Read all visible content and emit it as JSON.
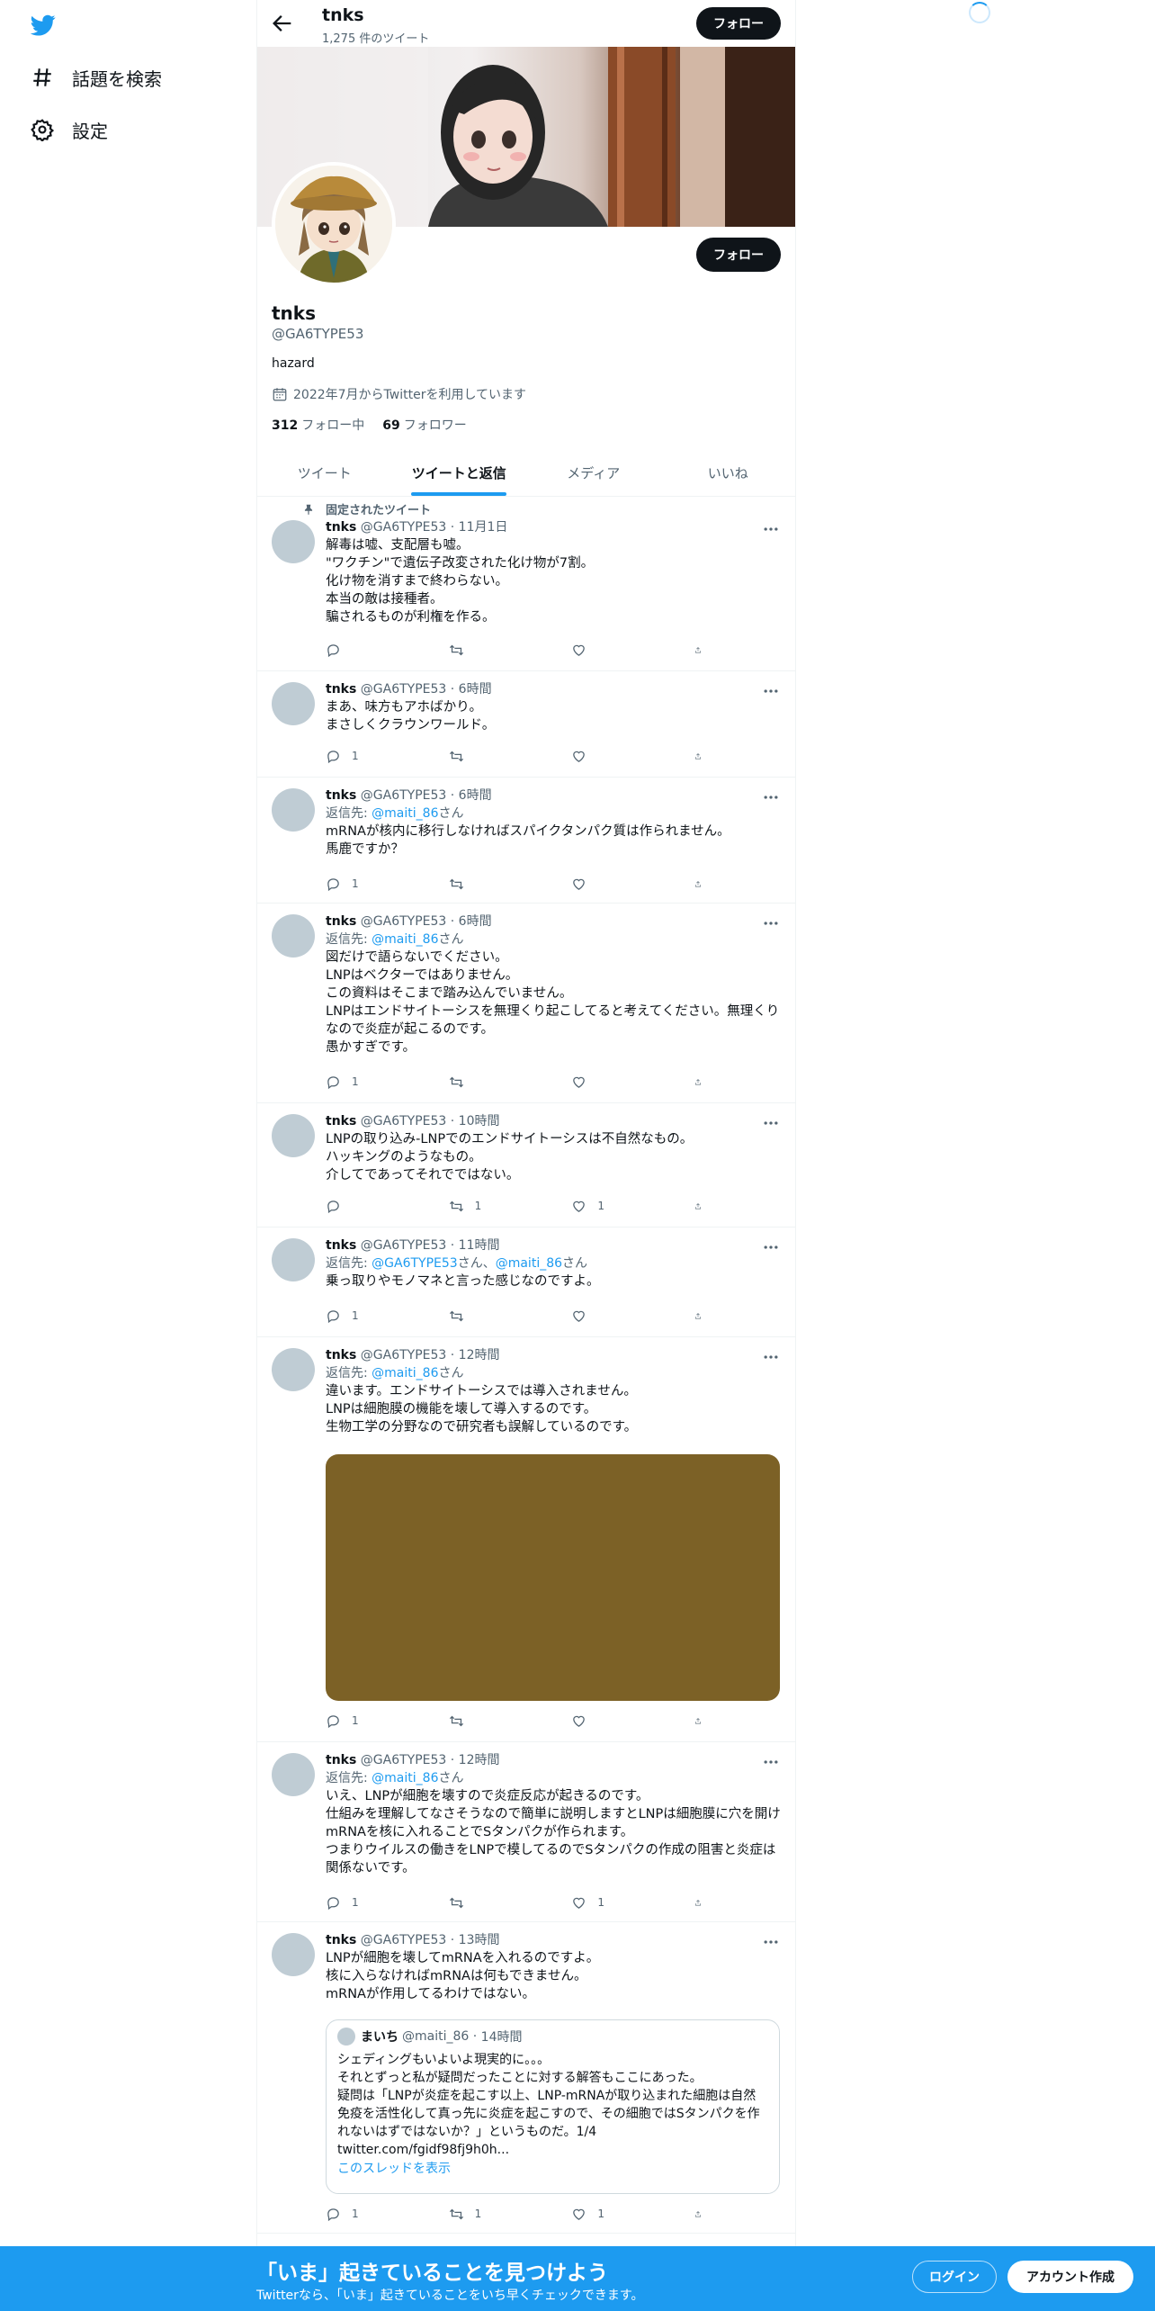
{
  "nav": {
    "explore_label": "話題を検索",
    "settings_label": "設定"
  },
  "header": {
    "title": "tnks",
    "tweet_count": "1,275 件のツイート",
    "follow_label": "フォロー"
  },
  "profile": {
    "name": "tnks",
    "handle": "@GA6TYPE53",
    "bio": "hazard",
    "joined": "2022年7月からTwitterを利用しています",
    "following_count": "312",
    "following_label": "フォロー中",
    "followers_count": "69",
    "followers_label": "フォロワー",
    "follow_label": "フォロー"
  },
  "tabs": [
    "ツイート",
    "ツイートと返信",
    "メディア",
    "いいね"
  ],
  "pinned_label": "固定されたツイート",
  "tweets": [
    {
      "name": "tnks",
      "handle": "@GA6TYPE53",
      "time": "11月1日",
      "text": "解毒は嘘、支配層も嘘。\n\"ワクチン\"で遺伝子改変された化け物が7割。\n化け物を消すまで終わらない。\n本当の敵は接種者。\n騙されるものが利権を作る。",
      "replies": "",
      "retweets": "",
      "likes": ""
    },
    {
      "name": "tnks",
      "handle": "@GA6TYPE53",
      "time": "6時間",
      "text": "まあ、味方もアホばかり。\nまさしくクラウンワールド。",
      "replies": "1",
      "retweets": "",
      "likes": ""
    },
    {
      "name": "tnks",
      "handle": "@GA6TYPE53",
      "time": "6時間",
      "reply_prefix": "返信先: ",
      "reply_to": "@maiti_86",
      "reply_suffix": "さん",
      "text": "mRNAが核内に移行しなければスパイクタンパク質は作られません。\n馬鹿ですか？",
      "replies": "1",
      "retweets": "",
      "likes": ""
    },
    {
      "name": "tnks",
      "handle": "@GA6TYPE53",
      "time": "6時間",
      "reply_prefix": "返信先: ",
      "reply_to": "@maiti_86",
      "reply_suffix": "さん",
      "text": "図だけで語らないでください。\nLNPはベクターではありません。\nこの資料はそこまで踏み込んでいません。\nLNPはエンドサイトーシスを無理くり起こしてると考えてください。無理くりなので炎症が起こるのです。\n愚かすぎです。",
      "replies": "1",
      "retweets": "",
      "likes": ""
    },
    {
      "name": "tnks",
      "handle": "@GA6TYPE53",
      "time": "10時間",
      "text": "LNPの取り込み-LNPでのエンドサイトーシスは不自然なもの。\nハッキングのようなもの。\n介してであってそれでではない。",
      "replies": "",
      "retweets": "1",
      "likes": "1"
    },
    {
      "name": "tnks",
      "handle": "@GA6TYPE53",
      "time": "11時間",
      "reply_prefix": "返信先: ",
      "reply_to": "@GA6TYPE53",
      "reply_mid": "さん、",
      "reply_to2": "@maiti_86",
      "reply_suffix": "さん",
      "text": "乗っ取りやモノマネと言った感じなのですよ。",
      "replies": "1",
      "retweets": "",
      "likes": ""
    },
    {
      "name": "tnks",
      "handle": "@GA6TYPE53",
      "time": "12時間",
      "reply_prefix": "返信先: ",
      "reply_to": "@maiti_86",
      "reply_suffix": "さん",
      "text": "違います。エンドサイトーシスでは導入されません。\nLNPは細胞膜の機能を壊して導入するのです。\n生物工学の分野なので研究者も誤解しているのです。",
      "replies": "1",
      "retweets": "",
      "likes": ""
    },
    {
      "name": "tnks",
      "handle": "@GA6TYPE53",
      "time": "12時間",
      "reply_prefix": "返信先: ",
      "reply_to": "@maiti_86",
      "reply_suffix": "さん",
      "text": "いえ、LNPが細胞を壊すので炎症反応が起きるのです。\n仕組みを理解してなさそうなので簡単に説明しますとLNPは細胞膜に穴を開けmRNAを核に入れることでSタンパクが作られます。\nつまりウイルスの働きをLNPで模してるのでSタンパクの作成の阻害と炎症は関係ないです。",
      "replies": "1",
      "retweets": "",
      "likes": "1"
    },
    {
      "name": "tnks",
      "handle": "@GA6TYPE53",
      "time": "13時間",
      "text": "LNPが細胞を壊してmRNAを入れるのですよ。\n核に入らなければmRNAは何もできません。\nmRNAが作用してるわけではない。",
      "replies": "1",
      "retweets": "1",
      "likes": "1",
      "quote": {
        "name": "まいち",
        "handle": "@maiti_86",
        "time": "14時間",
        "text": "シェディングもいよいよ現実的に。。。\nそれとずっと私が疑問だったことに対する解答もここにあった。\n疑問は「LNPが炎症を起こす以上、LNP-mRNAが取り込まれた細胞は自然免疫を活性化して真っ先に炎症を起こすので、その細胞ではSタンパクを作れないはずではないか？」というものだ。1/4\ntwitter.com/fgidf98fj9h0h...",
        "thread_link": "このスレッドを表示"
      }
    }
  ],
  "bottom_bar": {
    "headline": "「いま」起きていることを見つけよう",
    "sub": "Twitterなら、「いま」起きていることをいち早くチェックできます。",
    "login_label": "ログイン",
    "signup_label": "アカウント作成"
  },
  "colors": {
    "accent": "#1d9bf0",
    "text": "#0f1419",
    "secondary": "#536471",
    "media_placeholder": "#7c6126"
  }
}
